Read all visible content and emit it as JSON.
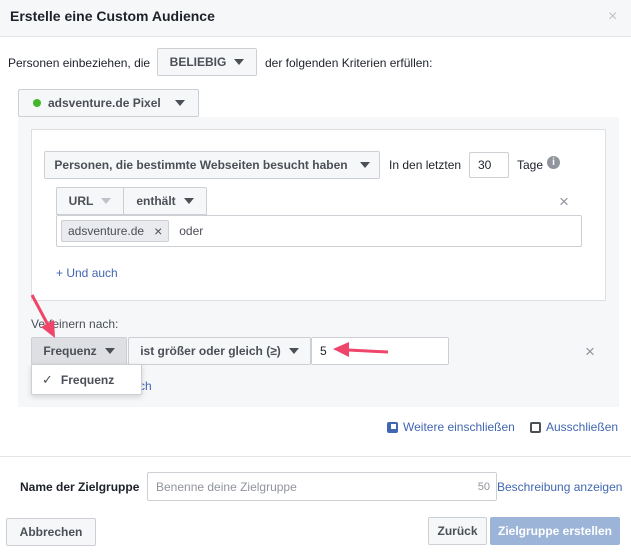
{
  "dialog": {
    "title": "Erstelle eine Custom Audience",
    "close_glyph": "×"
  },
  "criteria": {
    "prefix": "Personen einbeziehen, die",
    "mode": "BELIEBIG",
    "suffix": "der folgenden Kriterien erfüllen:"
  },
  "pixel": {
    "label": "adsventure.de Pixel",
    "status_color": "#42b72a"
  },
  "rule": {
    "type": "Personen, die bestimmte Webseiten besucht haben",
    "days_label": "In den letzten",
    "days_value": "30",
    "days_unit": "Tage",
    "info_glyph": "i",
    "url_field": "URL",
    "operator": "enthält",
    "remove_glyph": "×",
    "tag": "adsventure.de",
    "tag_remove_glyph": "×",
    "tag_placeholder": "oder",
    "add_and": "+ Und auch"
  },
  "refine": {
    "label": "Verfeinern nach:",
    "field": "Frequenz",
    "operator": "ist größer oder gleich (≥)",
    "value": "5",
    "remove_glyph": "×",
    "menu_check": "✓",
    "menu_item": "Frequenz",
    "partial_link": "ch"
  },
  "actions": {
    "include_more": "Weitere einschließen",
    "exclude": "Ausschließen"
  },
  "name": {
    "label": "Name der Zielgruppe",
    "placeholder": "Benenne deine Zielgruppe",
    "char_count": "50",
    "description_link": "Beschreibung anzeigen"
  },
  "footer": {
    "cancel": "Abbrechen",
    "back": "Zurück",
    "create": "Zielgruppe erstellen"
  },
  "colors": {
    "link": "#4267b2",
    "primary_disabled": "#9cb4d8",
    "annotation_arrow": "#f0456b"
  }
}
